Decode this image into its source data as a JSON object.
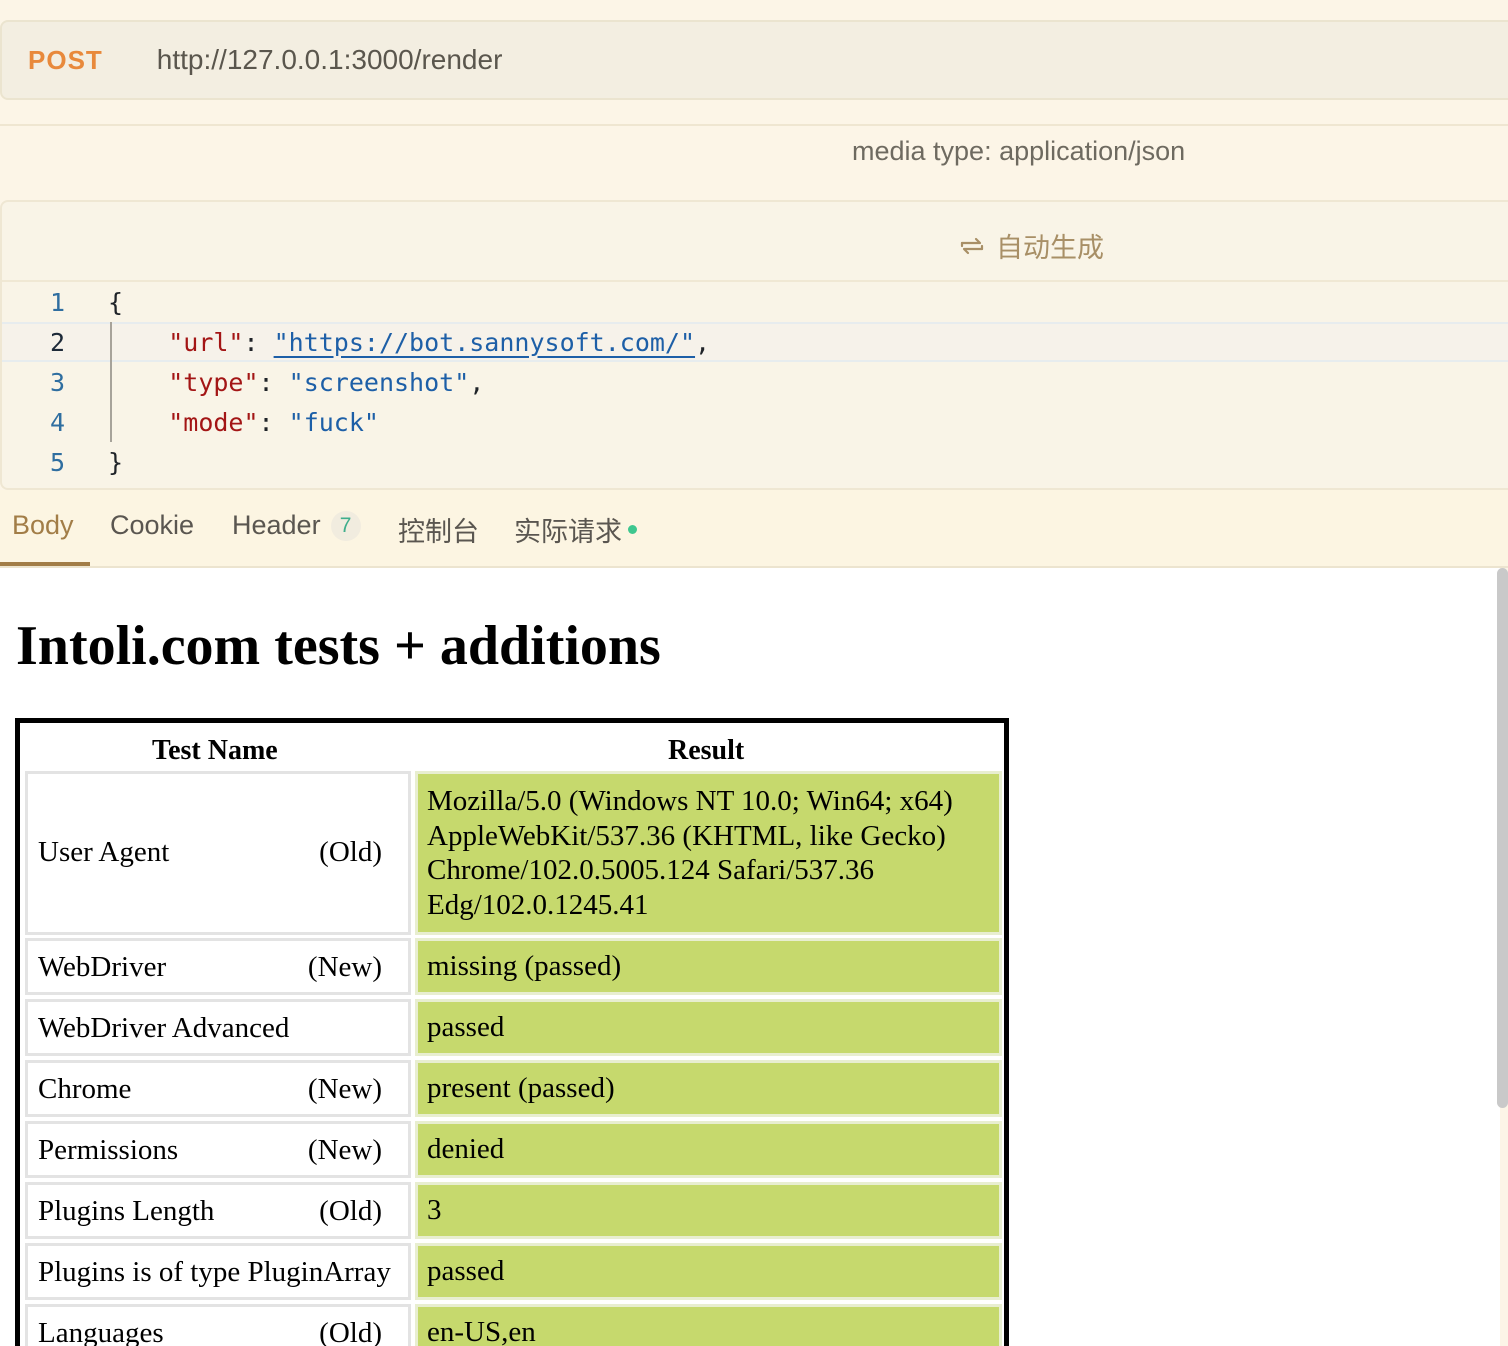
{
  "request": {
    "method": "POST",
    "url": "http://127.0.0.1:3000/render",
    "media_type": "media type: application/json",
    "autogen_label": "自动生成"
  },
  "editor": {
    "line_numbers": [
      "1",
      "2",
      "3",
      "4",
      "5"
    ],
    "open_brace": "{",
    "close_brace": "}",
    "fields": [
      {
        "key": "\"url\"",
        "value": "\"https://bot.sannysoft.com/\"",
        "is_link": true
      },
      {
        "key": "\"type\"",
        "value": "\"screenshot\"",
        "is_link": false
      },
      {
        "key": "\"mode\"",
        "value": "\"fuck\"",
        "is_link": false
      }
    ]
  },
  "tabs": {
    "body": "Body",
    "cookie": "Cookie",
    "header": "Header",
    "header_count": "7",
    "console": "控制台",
    "actual_request": "实际请求"
  },
  "preview": {
    "title": "Intoli.com tests + additions",
    "col_test_name": "Test Name",
    "col_result": "Result",
    "rows": [
      {
        "name": "User Agent",
        "tag": "(Old)",
        "result_lines": [
          "Mozilla/5.0 (Windows NT 10.0; Win64; x64)",
          "AppleWebKit/537.36 (KHTML, like Gecko)",
          "Chrome/102.0.5005.124 Safari/537.36",
          "Edg/102.0.1245.41"
        ]
      },
      {
        "name": "WebDriver",
        "tag": "(New)",
        "result": "missing (passed)"
      },
      {
        "name": "WebDriver Advanced",
        "tag": "",
        "result": "passed"
      },
      {
        "name": "Chrome",
        "tag": "(New)",
        "result": "present (passed)"
      },
      {
        "name": "Permissions",
        "tag": "(New)",
        "result": "denied"
      },
      {
        "name": "Plugins Length",
        "tag": "(Old)",
        "result": "3"
      },
      {
        "name": "Plugins is of type PluginArray",
        "tag": "",
        "result": "passed"
      },
      {
        "name": "Languages",
        "tag": "(Old)",
        "result": "en-US,en"
      }
    ]
  },
  "colors": {
    "method": "#e8893b",
    "active_tab": "#a27d47",
    "passed_cell": "#c6d96d",
    "status_dot": "#3ec78f"
  }
}
